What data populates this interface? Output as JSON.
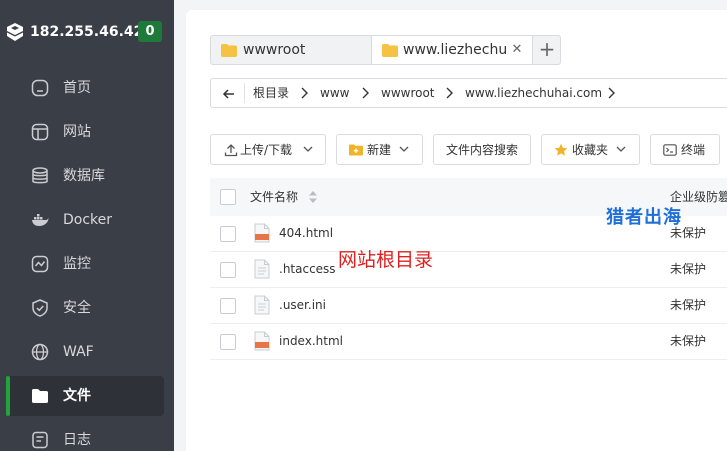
{
  "sidebar": {
    "server_ip": "182.255.46.42",
    "badge": "0",
    "items": [
      {
        "label": "首页",
        "icon": "home-icon"
      },
      {
        "label": "网站",
        "icon": "website-icon"
      },
      {
        "label": "数据库",
        "icon": "database-icon"
      },
      {
        "label": "Docker",
        "icon": "docker-icon"
      },
      {
        "label": "监控",
        "icon": "monitor-icon"
      },
      {
        "label": "安全",
        "icon": "shield-icon"
      },
      {
        "label": "WAF",
        "icon": "waf-icon"
      },
      {
        "label": "文件",
        "icon": "folder-icon",
        "active": true
      },
      {
        "label": "日志",
        "icon": "log-icon"
      }
    ]
  },
  "tabs": {
    "items": [
      {
        "label": "wwwroot"
      },
      {
        "label": "www.liezhechu",
        "active": true
      }
    ],
    "add_label": "+"
  },
  "path": {
    "crumbs": [
      "根目录",
      "www",
      "wwwroot",
      "www.liezhechuhai.com"
    ]
  },
  "toolbar": {
    "upload_label": "上传/下载",
    "new_label": "新建",
    "search_label": "文件内容搜索",
    "favorites_label": "收藏夹",
    "terminal_label": "终端"
  },
  "table": {
    "header_name": "文件名称",
    "header_protection": "企业级防篡",
    "rows": [
      {
        "name": "404.html",
        "type": "html",
        "protection": "未保护"
      },
      {
        "name": ".htaccess",
        "type": "text",
        "protection": "未保护"
      },
      {
        "name": ".user.ini",
        "type": "text",
        "protection": "未保护"
      },
      {
        "name": "index.html",
        "type": "html",
        "protection": "未保护"
      }
    ]
  },
  "annotation": "网站根目录",
  "watermark": "猎者出海",
  "colors": {
    "sidebar_bg": "#3a3f47",
    "accent_green": "#20a53a",
    "annotation_red": "#e02020",
    "watermark_blue": "#1f6fd8"
  }
}
